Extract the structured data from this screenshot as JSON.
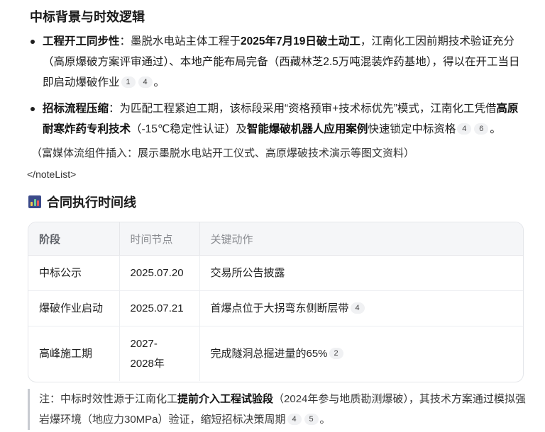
{
  "section1": {
    "heading": "中标背景与时效逻辑",
    "bullets": [
      {
        "title": "工程开工同步性",
        "t1": "：墨脱水电站主体工程于",
        "b1": "2025年7月19日破土动工",
        "t2": "，江南化工因前期技术验证充分（高原爆破方案评审通过）、本地产能布局完备（西藏林芝2.5万吨混装炸药基地），得以在开工当日即启动爆破作业",
        "cites": [
          "1",
          "4"
        ],
        "end": "。"
      },
      {
        "title": "招标流程压缩",
        "t1": "：为匹配工程紧迫工期，该标段采用“资格预审+技术标优先”模式，江南化工凭借",
        "b1": "高原耐寒炸药专利技术",
        "t2": "（-15℃稳定性认证）及",
        "b2": "智能爆破机器人应用案例",
        "t3": "快速锁定中标资格",
        "cites": [
          "4",
          "6"
        ],
        "end": "。"
      }
    ],
    "rich_note": "（富媒体流组件插入：展示墨脱水电站开工仪式、高原爆破技术演示等图文资料）",
    "close_tag": "</noteList>"
  },
  "section2": {
    "heading": "合同执行时间线",
    "icon": "bar-chart-icon",
    "table": {
      "headers": [
        "阶段",
        "时间节点",
        "关键动作"
      ],
      "rows": [
        {
          "stage": "中标公示",
          "time": "2025.07.20",
          "action": "交易所公告披露",
          "cite": ""
        },
        {
          "stage": "爆破作业启动",
          "time": "2025.07.21",
          "action": "首爆点位于大拐弯东侧断层带",
          "cite": "4"
        },
        {
          "stage": "高峰施工期",
          "time": "2027-2028年",
          "action": "完成隧洞总掘进量的65%",
          "cite": "2"
        }
      ]
    }
  },
  "note": {
    "t1": "注：中标时效性源于江南化工",
    "b1": "提前介入工程试验段",
    "t2": "（2024年参与地质勘测爆破），其技术方案通过模拟强岩爆环境（地应力30MPa）验证，缩短招标决策周期",
    "cites": [
      "4",
      "5"
    ],
    "end": "。"
  },
  "colors": {
    "bar_icon": "#3b4a8a",
    "table_border": "#e4e6ea",
    "header_bg": "#f5f6f8",
    "cite_bg": "#f0f1f3"
  }
}
